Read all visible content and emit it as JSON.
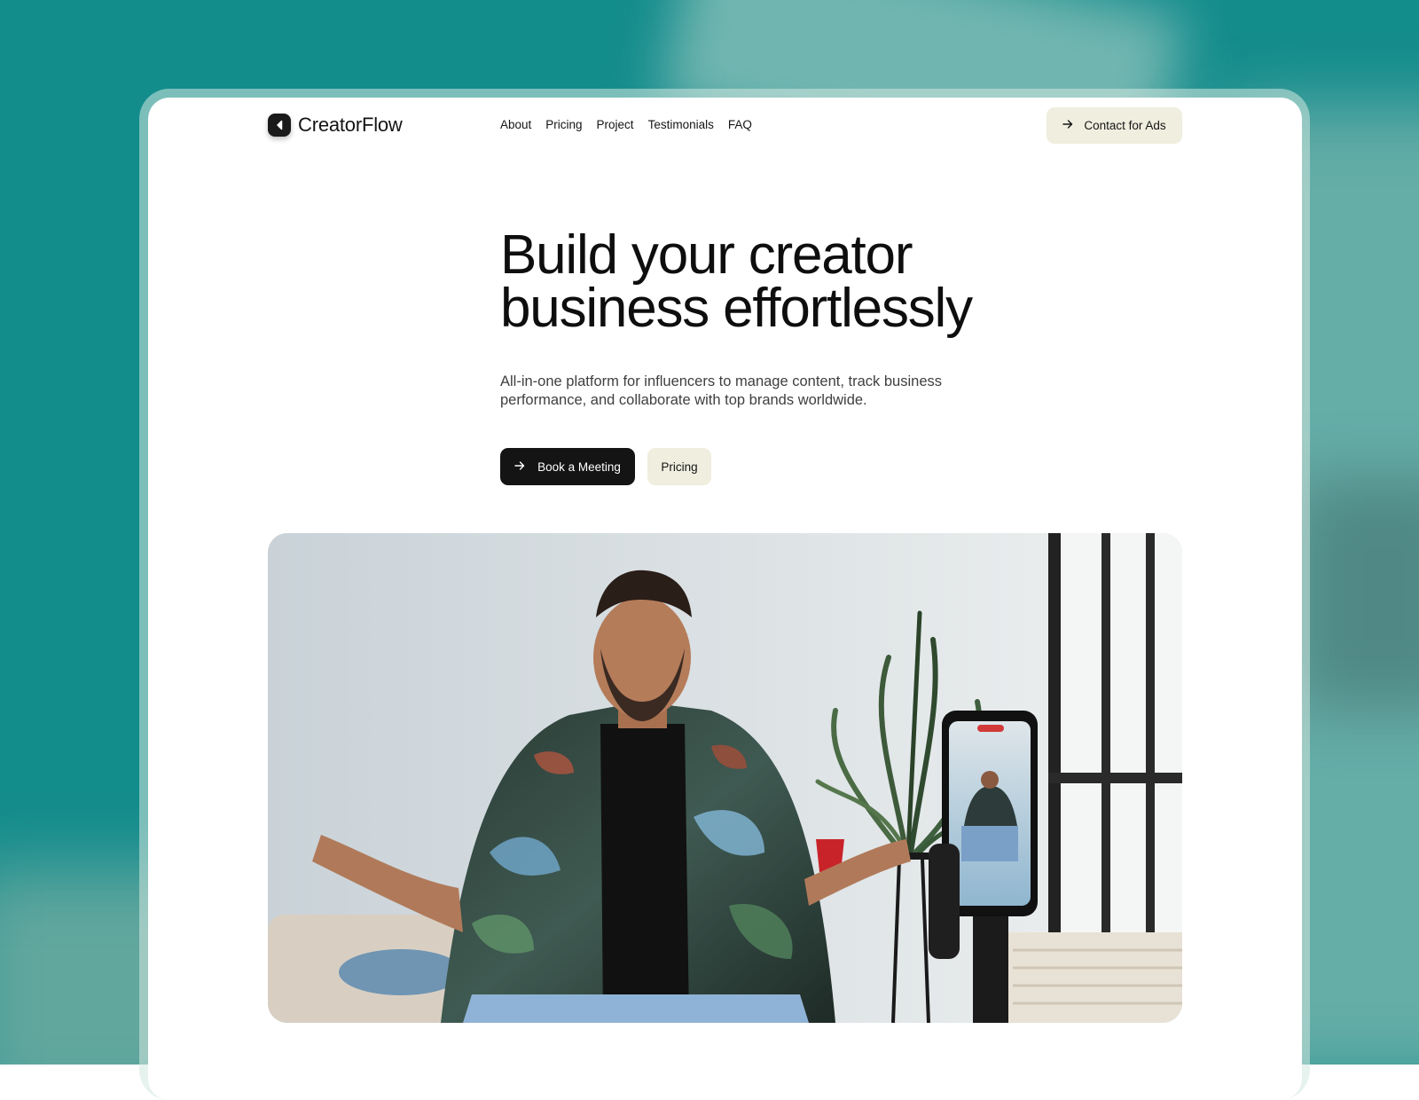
{
  "brand": {
    "name": "CreatorFlow",
    "logo_icon": "chevron-left-logo-icon"
  },
  "nav": {
    "links": [
      "About",
      "Pricing",
      "Project",
      "Testimonials",
      "FAQ"
    ],
    "cta_label": "Contact for Ads",
    "cta_icon": "arrow-right-icon"
  },
  "hero": {
    "title_line1": "Build your creator",
    "title_line2": "business effortlessly",
    "subtitle_line1": "All-in-one platform for influencers to manage content, track business",
    "subtitle_line2": "performance, and collaborate with top brands worldwide.",
    "primary_button": "Book a Meeting",
    "secondary_button": "Pricing",
    "image_alt": "creator filming with phone on gimbal"
  },
  "colors": {
    "background": "#138c8c",
    "button_dark": "#141414",
    "button_light": "#efeedf",
    "text": "#0e0e0e"
  }
}
